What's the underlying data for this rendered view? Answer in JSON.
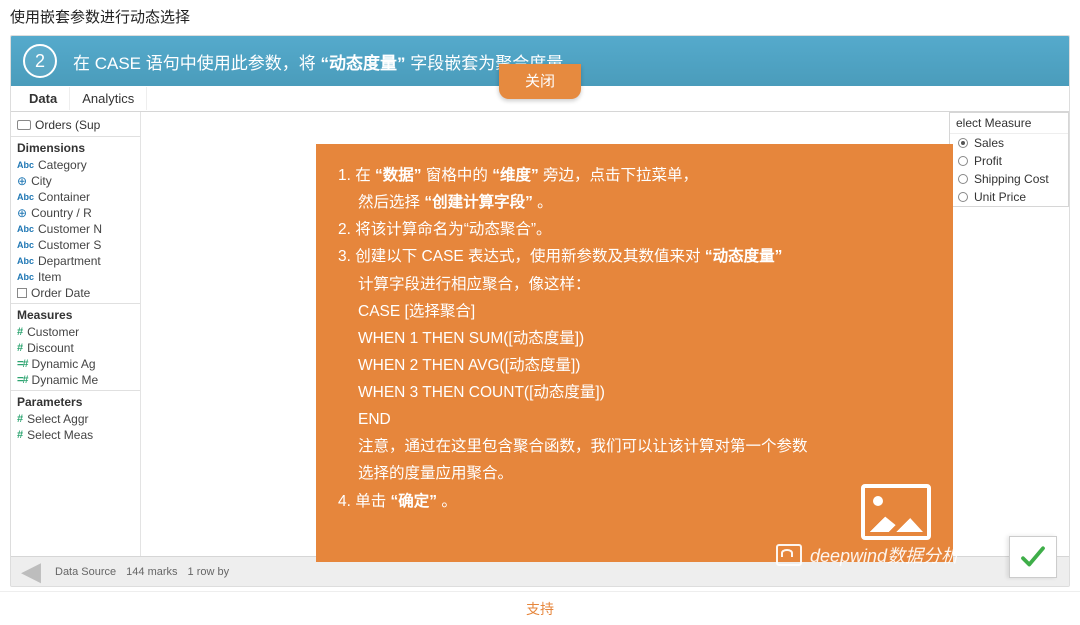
{
  "page_title": "使用嵌套参数进行动态选择",
  "banner": {
    "step": "2",
    "text_before": "在 CASE 语句中使用此参数，将 ",
    "text_quoted": "“动态度量”",
    "text_after": " 字段嵌套为聚合度量。"
  },
  "close_tab": "关闭",
  "tabs": {
    "data": "Data",
    "analytics": "Analytics"
  },
  "datasource": "Orders (Sup",
  "sections": {
    "dimensions": "Dimensions",
    "measures": "Measures",
    "parameters": "Parameters"
  },
  "dims": [
    "Category",
    "City",
    "Container",
    "Country / R",
    "Customer N",
    "Customer S",
    "Department",
    "Item",
    "Order Date"
  ],
  "meas": [
    "Customer",
    "Discount",
    "Dynamic Ag",
    "Dynamic Me"
  ],
  "params": [
    "Select Aggr",
    "Select Meas"
  ],
  "measure_panel": {
    "header": "elect Measure",
    "items": [
      "Sales",
      "Profit",
      "Shipping Cost",
      "Unit Price"
    ],
    "selected": 0
  },
  "statusbar": {
    "left1": "Data Source",
    "left2": "144 marks",
    "left3": "1 row by"
  },
  "orange": {
    "li1_a": "1. 在 ",
    "li1_b": "“数据”",
    "li1_c": " 窗格中的 ",
    "li1_d": "“维度”",
    "li1_e": " 旁边，点击下拉菜单，",
    "li1_f": "然后选择 ",
    "li1_g": "“创建计算字段”",
    "li1_h": " 。",
    "li2": "2. 将该计算命名为“动态聚合”。",
    "li3_a": "3. 创建以下 CASE 表达式，使用新参数及其数值来对 ",
    "li3_b": "“动态度量”",
    "li3_c": "计算字段进行相应聚合，像这样：",
    "code1": "CASE [选择聚合]",
    "code2": "WHEN 1 THEN SUM([动态度量])",
    "code3": "WHEN 2 THEN AVG([动态度量])",
    "code4": "WHEN 3 THEN COUNT([动态度量])",
    "code5": "END",
    "note1": "注意，通过在这里包含聚合函数，我们可以让该计算对第一个参数",
    "note2": "选择的度量应用聚合。",
    "li4_a": "4. 单击 ",
    "li4_b": "“确定”",
    "li4_c": " 。"
  },
  "watermark": "deepwind数据分析",
  "support_link": "支持"
}
